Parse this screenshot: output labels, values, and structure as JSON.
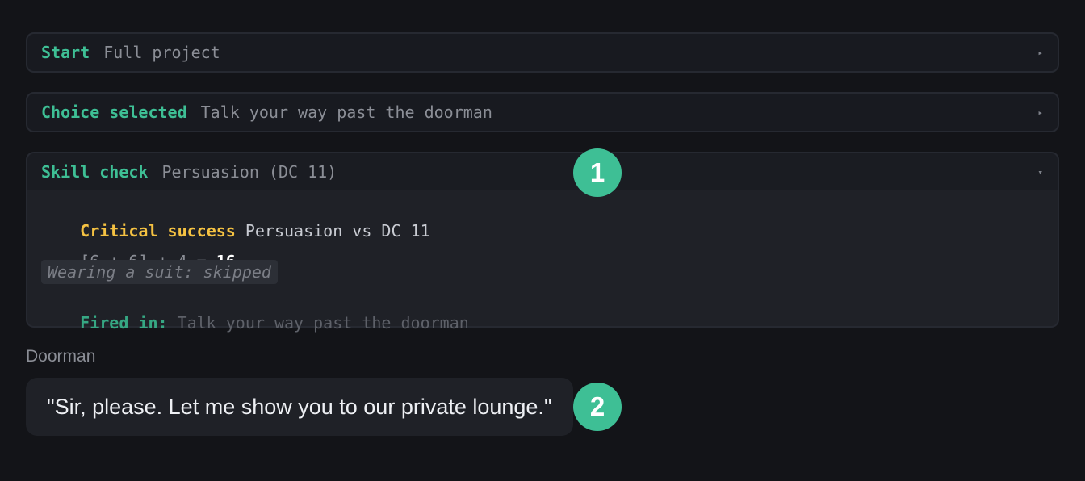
{
  "rows": [
    {
      "type": "Start",
      "desc": "Full project",
      "arrow": "▸"
    },
    {
      "type": "Choice selected",
      "desc": "Talk your way past the doorman",
      "arrow": "▸"
    },
    {
      "type": "Skill check",
      "desc": "Persuasion (DC 11)",
      "arrow": "▾"
    }
  ],
  "skill_check_details": {
    "result": "Critical success",
    "summary": "Persuasion vs DC 11",
    "roll_formula": "[6 + 6] + 4 = ",
    "roll_total": "16",
    "modifier_note": "Wearing a suit: skipped",
    "fired_in_label": "Fired in:",
    "fired_in_value": "Talk your way past the doorman"
  },
  "dialogue": {
    "speaker": "Doorman",
    "line": "\"Sir, please. Let me show you to our private lounge.\""
  },
  "markers": [
    "1",
    "2"
  ],
  "colors": {
    "background": "#131418",
    "accent_green": "#3ebf95",
    "critical_yellow": "#f5c242"
  }
}
